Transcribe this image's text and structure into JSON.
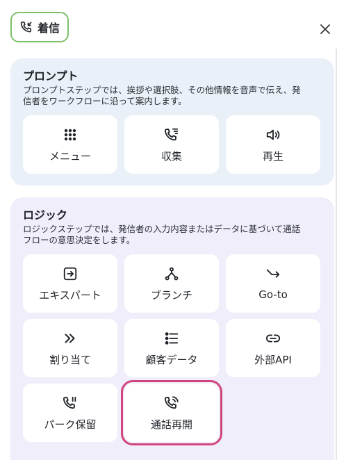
{
  "header": {
    "title": "着信",
    "icon": "incoming-call-icon"
  },
  "close": {
    "icon": "close-icon"
  },
  "prompt": {
    "title": "プロンプト",
    "description_line1": "プロンプトステップでは、挨拶や選択肢、その他情報を音声で伝え、発",
    "description_line2": "信者をワークフローに沿って案内します。",
    "tiles": [
      {
        "label": "メニュー",
        "icon": "menu-grid-icon"
      },
      {
        "label": "収集",
        "icon": "phone-collect-icon"
      },
      {
        "label": "再生",
        "icon": "speaker-icon"
      }
    ]
  },
  "logic": {
    "title": "ロジック",
    "description_line1": "ロジックステップでは、発信者の入力内容またはデータに基づいて通話",
    "description_line2": "フローの意思決定をします。",
    "tiles": [
      {
        "label": "エキスパート",
        "icon": "export-icon"
      },
      {
        "label": "ブランチ",
        "icon": "branch-icon"
      },
      {
        "label": "Go-to",
        "icon": "goto-arrow-icon"
      },
      {
        "label": "割り当て",
        "icon": "double-chevron-icon"
      },
      {
        "label": "顧客データ",
        "icon": "list-icon"
      },
      {
        "label": "外部API",
        "icon": "link-icon"
      },
      {
        "label": "パーク保留",
        "icon": "phone-hold-icon"
      },
      {
        "label": "通話再開",
        "icon": "phone-resume-icon"
      }
    ]
  },
  "colors": {
    "header_border": "#7ec06a",
    "prompt_bg": "#e9f0f8",
    "logic_bg": "#efeefa",
    "selected_outline": "#d0457d"
  }
}
